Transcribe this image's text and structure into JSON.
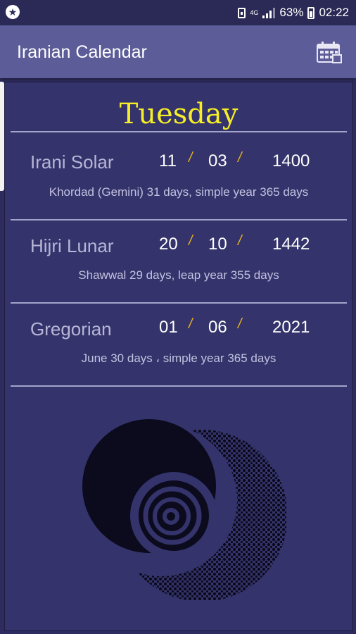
{
  "status_bar": {
    "network": "4G",
    "battery_percent": "63%",
    "time": "02:22"
  },
  "app_bar": {
    "title": "Iranian Calendar",
    "icon": "calendar-icon"
  },
  "weekday": "Tuesday",
  "calendars": [
    {
      "name": "Irani Solar",
      "day": "11",
      "month": "03",
      "year": "1400",
      "description": "Khordad (Gemini) 31 days, simple year 365 days"
    },
    {
      "name": "Hijri Lunar",
      "day": "20",
      "month": "10",
      "year": "1442",
      "description": "Shawwal 29 days, leap year 355 days"
    },
    {
      "name": "Gregorian",
      "day": "01",
      "month": "06",
      "year": "2021",
      "description": "June 30 days ، simple year 365 days"
    }
  ],
  "separator": "/",
  "colors": {
    "app_bar": "#5c5c99",
    "background": "#34336b",
    "weekday": "#f6ef27",
    "slash": "#e9b21e"
  }
}
